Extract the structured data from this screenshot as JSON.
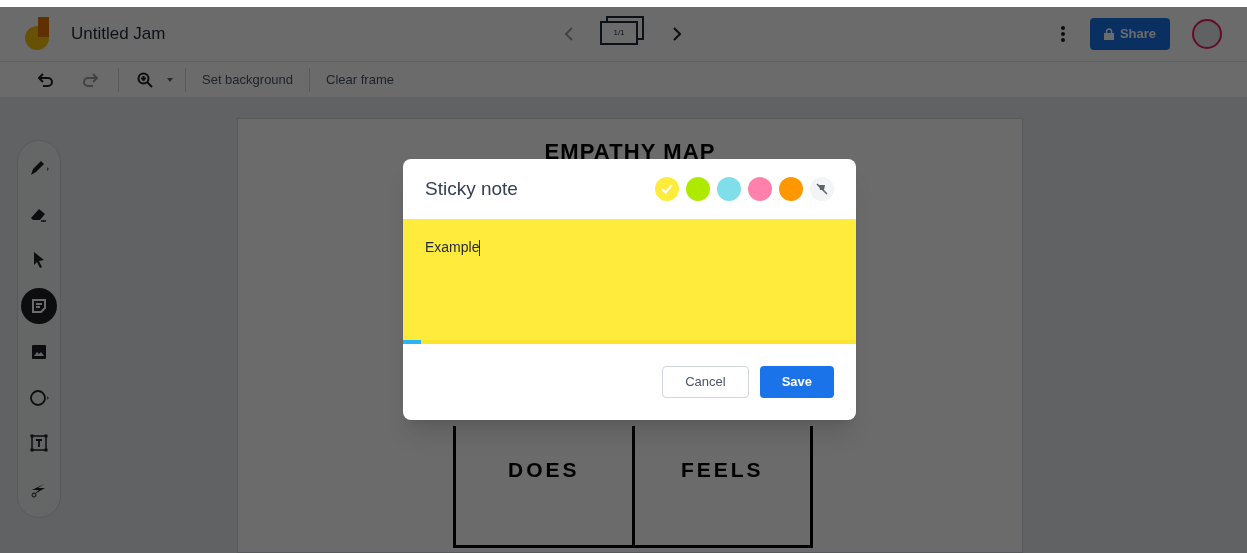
{
  "header": {
    "title": "Untitled Jam",
    "frame_counter": "1/1",
    "share_label": "Share"
  },
  "toolbar": {
    "actions": [
      "Set background",
      "Clear frame"
    ]
  },
  "tools": [
    {
      "kind": "pen",
      "selected": false
    },
    {
      "kind": "eraser",
      "selected": false
    },
    {
      "kind": "pointer",
      "selected": false
    },
    {
      "kind": "sticky",
      "selected": true
    },
    {
      "kind": "image",
      "selected": false
    },
    {
      "kind": "circle",
      "selected": false
    },
    {
      "kind": "textbox",
      "selected": false
    },
    {
      "kind": "laser",
      "selected": false
    }
  ],
  "canvas": {
    "title": "EMPATHY MAP",
    "quadrants": [
      "DOES",
      "FEELS"
    ]
  },
  "dialog": {
    "title": "Sticky note",
    "swatches": [
      {
        "kind": "color",
        "color": "#ffeb3b",
        "selected": true
      },
      {
        "kind": "color",
        "color": "#aeea00",
        "selected": false
      },
      {
        "kind": "color",
        "color": "#80deea",
        "selected": false
      },
      {
        "kind": "color",
        "color": "#ff80ab",
        "selected": false
      },
      {
        "kind": "color",
        "color": "#ff9800",
        "selected": false
      },
      {
        "kind": "none",
        "selected": false
      }
    ],
    "value": "Example",
    "level": 0.04,
    "buttons": [
      {
        "kind": "secondary",
        "label": "Cancel"
      },
      {
        "kind": "primary",
        "label": "Save"
      }
    ]
  }
}
